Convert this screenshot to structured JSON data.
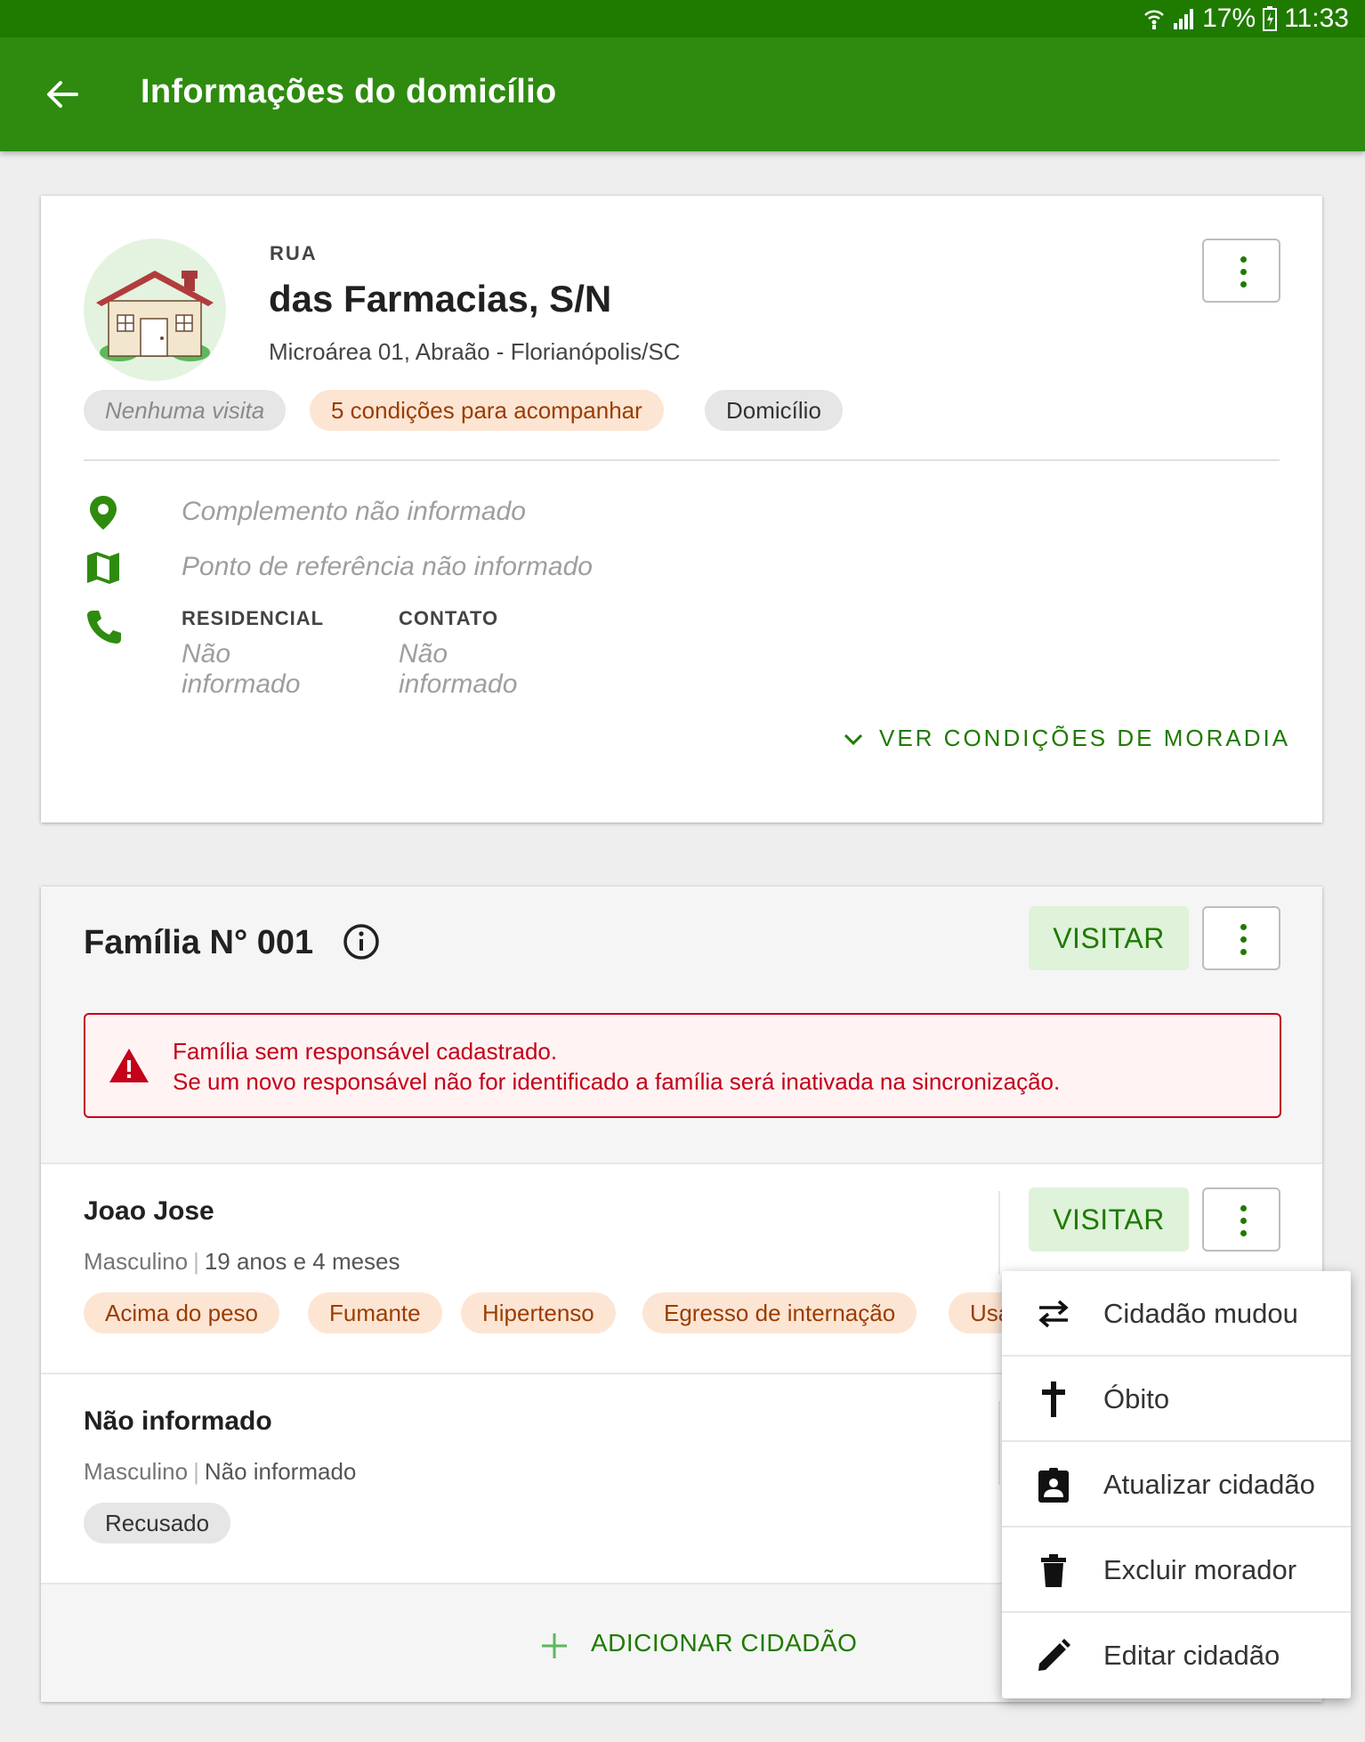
{
  "status_bar": {
    "battery": "17%",
    "time": "11:33"
  },
  "app_bar": {
    "title": "Informações do domicílio"
  },
  "address": {
    "type_label": "RUA",
    "street": "das Farmacias, S/N",
    "locality": "Microárea 01, Abraão - Florianópolis/SC",
    "chips": [
      "Nenhuma visita",
      "5 condições para acompanhar",
      "Domicílio"
    ],
    "complement": "Complemento não informado",
    "reference": "Ponto de referência não informado",
    "phone_residential_label": "RESIDENCIAL",
    "phone_residential_value": "Não informado",
    "phone_contact_label": "CONTATO",
    "phone_contact_value": "Não informado",
    "expand_link": "VER CONDIÇÕES DE MORADIA"
  },
  "family": {
    "title": "Família N° 001",
    "visit_label": "VISITAR",
    "alert_line1": "Família sem responsável cadastrado.",
    "alert_line2": "Se um novo responsável não for identificado a família será inativada na sincronização.",
    "members": [
      {
        "name": "Joao Jose",
        "sex": "Masculino",
        "age": "19 anos e 4 meses",
        "visit_label": "VISITAR",
        "chips": [
          "Acima do peso",
          "Fumante",
          "Hipertenso",
          "Egresso de internação",
          "Usa"
        ]
      },
      {
        "name": "Não informado",
        "sex": "Masculino",
        "age": "Não informado",
        "chips": [
          "Recusado"
        ]
      }
    ],
    "add_label": "ADICIONAR CIDADÃO"
  },
  "menu": {
    "items": [
      {
        "label": "Cidadão mudou",
        "icon": "swap-icon"
      },
      {
        "label": "Óbito",
        "icon": "cross-icon"
      },
      {
        "label": "Atualizar cidadão",
        "icon": "person-clipboard-icon"
      },
      {
        "label": "Excluir morador",
        "icon": "trash-icon"
      },
      {
        "label": "Editar cidadão",
        "icon": "pencil-icon"
      }
    ]
  },
  "colors": {
    "primary": "#2e8b0f",
    "status_bar": "#1f7a00",
    "accent_text": "#1f7a00",
    "alert": "#c4001a",
    "chip_orange_bg": "#fde5d4",
    "chip_orange_text": "#9a3d00"
  }
}
